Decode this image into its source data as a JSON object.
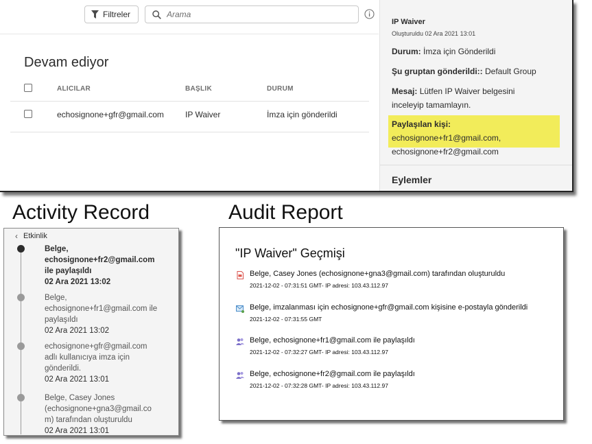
{
  "toolbar": {
    "filter_label": "Filtreler",
    "search_placeholder": "Arama"
  },
  "list": {
    "section_title": "Devam ediyor",
    "columns": [
      "ALICILAR",
      "BAŞLIK",
      "DURUM"
    ],
    "rows": [
      {
        "recipient": "echosignone+gfr@gmail.com",
        "title": "IP Waiver",
        "status": "İmza için gönderildi"
      }
    ]
  },
  "details": {
    "title": "IP Waiver",
    "created": "Oluşturuldu 02 Ara 2021 13:01",
    "status_label": "Durum:",
    "status_value": "İmza için Gönderildi",
    "group_label": "Şu gruptan gönderildi::",
    "group_value": "Default Group",
    "message_label": "Mesaj:",
    "message_value": "Lütfen IP Waiver belgesini inceleyip tamamlayın.",
    "shared_label": "Paylaşılan kişi:",
    "shared_value": "echosignone+fr1@gmail.com, echosignone+fr2@gmail.com",
    "actions_label": "Eylemler",
    "highlight_color": "#f2ec5a"
  },
  "captions": {
    "activity": "Activity Record",
    "audit": "Audit Report"
  },
  "activity": {
    "header": "Etkinlik",
    "items": [
      {
        "lines": [
          "Belge,",
          "echosignone+fr2@gmail.com",
          "ile paylaşıldı"
        ],
        "date": "02 Ara 2021 13:02",
        "active": true
      },
      {
        "lines": [
          "Belge,",
          "echosignone+fr1@gmail.com ile",
          "paylaşıldı"
        ],
        "date": "02 Ara 2021 13:02",
        "active": false
      },
      {
        "lines": [
          "echosignone+gfr@gmail.com",
          "adlı kullanıcıya imza için",
          "gönderildi."
        ],
        "date": "02 Ara 2021 13:01",
        "active": false
      },
      {
        "lines": [
          "Belge, Casey Jones",
          "(echosignone+gna3@gmail.co",
          "m) tarafından oluşturuldu"
        ],
        "date": "02 Ara 2021 13:01",
        "active": false
      }
    ]
  },
  "audit": {
    "title": "\"IP Waiver\" Geçmişi",
    "entries": [
      {
        "icon": "pdf-icon",
        "text": "Belge, Casey Jones (echosignone+gna3@gmail.com) tarafından oluşturuldu",
        "meta": "2021-12-02 - 07:31:51 GMT- IP adresi: 103.43.112.97"
      },
      {
        "icon": "email-icon",
        "text": "Belge, imzalanması için echosignone+gfr@gmail.com kişisine e-postayla gönderildi",
        "meta": "2021-12-02 - 07:31:55 GMT"
      },
      {
        "icon": "people-icon",
        "text": "Belge, echosignone+fr1@gmail.com ile paylaşıldı",
        "meta": "2021-12-02 - 07:32:27 GMT- IP adresi: 103.43.112.97"
      },
      {
        "icon": "people-icon",
        "text": "Belge, echosignone+fr2@gmail.com ile paylaşıldı",
        "meta": "2021-12-02 - 07:32:28 GMT- IP adresi: 103.43.112.97"
      }
    ]
  }
}
